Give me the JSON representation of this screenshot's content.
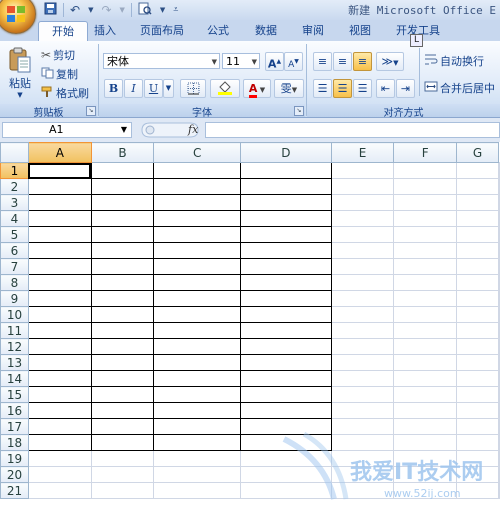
{
  "window": {
    "title": "新建 Microsoft Office E"
  },
  "tabs": [
    {
      "label": "开始",
      "active": true
    },
    {
      "label": "插入"
    },
    {
      "label": "页面布局"
    },
    {
      "label": "公式"
    },
    {
      "label": "数据"
    },
    {
      "label": "审阅"
    },
    {
      "label": "视图"
    },
    {
      "label": "开发工具"
    }
  ],
  "keytip": "L",
  "clipboard": {
    "paste": "粘贴",
    "cut": "剪切",
    "copy": "复制",
    "format_painter": "格式刷",
    "group_label": "剪贴板"
  },
  "font": {
    "name": "宋体",
    "size": "11",
    "bold": "B",
    "italic": "I",
    "underline": "U",
    "grow": "A",
    "shrink": "A",
    "color_letter": "A",
    "phonetic": "雯",
    "group_label": "字体"
  },
  "alignment": {
    "wrap_text": "自动换行",
    "merge_center": "合并后居中",
    "group_label": "对齐方式"
  },
  "formula_bar": {
    "name_box": "A1",
    "fx": "fx",
    "formula": ""
  },
  "sheet": {
    "columns": [
      "A",
      "B",
      "C",
      "D",
      "E",
      "F",
      "G"
    ],
    "rows": [
      "1",
      "2",
      "3",
      "4",
      "5",
      "6",
      "7",
      "8",
      "9",
      "10",
      "11",
      "12",
      "13",
      "14",
      "15",
      "16",
      "17",
      "18",
      "19",
      "20",
      "21"
    ],
    "active_cell": "A1",
    "bordered_range": "A1:D18"
  },
  "watermark": {
    "text": "我爱IT技术网",
    "url": "www.52ij.com"
  },
  "colors": {
    "accent": "#15428b",
    "highlight": "#f1c15f",
    "ribbon": "#dfeaf8"
  }
}
